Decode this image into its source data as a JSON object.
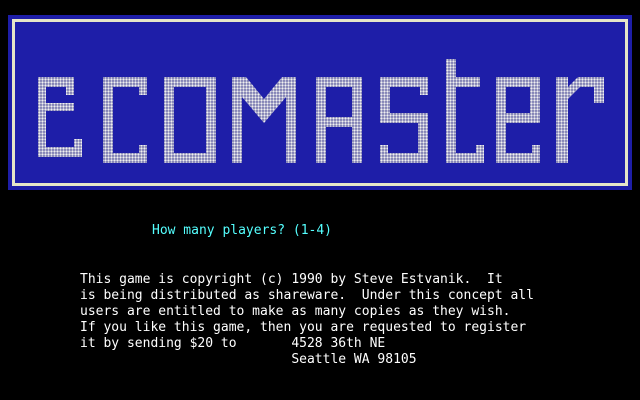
{
  "title": {
    "logo_text": "ecomaster",
    "banner_color": "#1e1ea8",
    "border_color": "#e6e6c8",
    "logo_color": "#e8e8e8"
  },
  "prompt": {
    "text": "How many players? (1-4)",
    "color": "#55ffff"
  },
  "notice": {
    "lines": [
      "This game is copyright (c) 1990 by Steve Estvanik.  It",
      "is being distributed as shareware.  Under this concept all",
      "users are entitled to make as many copies as they wish.",
      "If you like this game, then you are requested to register",
      "it by sending $20 to       4528 36th NE",
      "                           Seattle WA 98105"
    ],
    "color": "#ffffff"
  }
}
